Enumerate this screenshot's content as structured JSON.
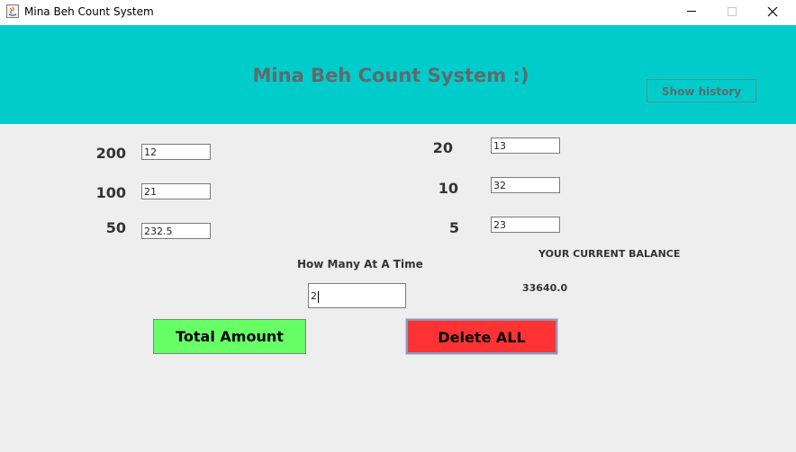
{
  "window": {
    "title": "Mina Beh Count System"
  },
  "header": {
    "title": "Mina Beh Count System :)",
    "history_button": "Show history",
    "background": "#00cccc"
  },
  "denominations": {
    "left": [
      {
        "label": "200",
        "value": "12"
      },
      {
        "label": "100",
        "value": "21"
      },
      {
        "label": "50",
        "value": "232.5"
      }
    ],
    "right": [
      {
        "label": "20",
        "value": "13"
      },
      {
        "label": "10",
        "value": "32"
      },
      {
        "label": "5",
        "value": "23"
      }
    ]
  },
  "quantity": {
    "label": "How Many At A Time",
    "value": "2"
  },
  "balance": {
    "label": "YOUR CURRENT BALANCE",
    "value": "33640.0"
  },
  "actions": {
    "total_label": "Total Amount",
    "total_color": "#66ff66",
    "delete_label": "Delete ALL",
    "delete_color": "#ff3333"
  }
}
